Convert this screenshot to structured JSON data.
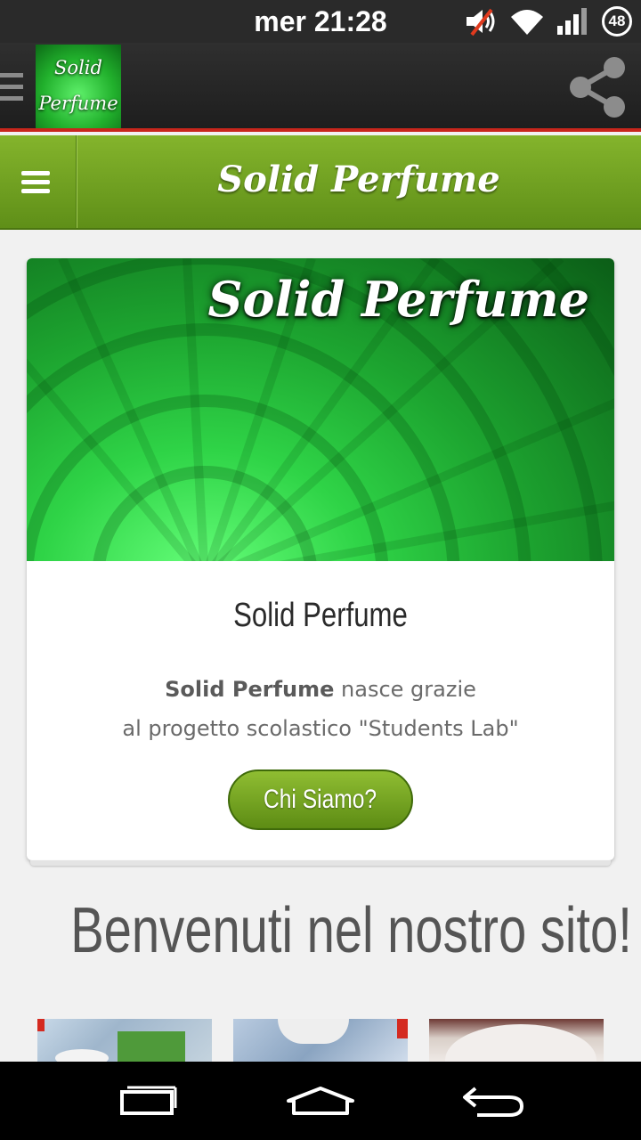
{
  "status_bar": {
    "time": "mer 21:28",
    "battery": "48",
    "icons": [
      "mute-icon",
      "wifi-icon",
      "signal-icon",
      "battery-icon"
    ]
  },
  "action_bar": {
    "logo_line1": "Solid",
    "logo_line2": "Perfume",
    "icons": [
      "drawer-icon",
      "share-icon"
    ]
  },
  "site_header": {
    "title": "Solid Perfume",
    "icon": "hamburger-menu-icon"
  },
  "card": {
    "banner_text": "Solid Perfume",
    "title": "Solid Perfume",
    "text_bold": "Solid Perfume",
    "text_line1_rest": " nasce grazie",
    "text_line2": "al progetto scolastico \"Students Lab\"",
    "button_label": "Chi Siamo?"
  },
  "welcome_heading": "Benvenuti nel nostro sito!",
  "colors": {
    "brand_green": "#6fa020",
    "accent_red": "#c8261c",
    "action_bar": "#2a2a2a"
  },
  "nav_bar": {
    "icons": [
      "recent-apps-icon",
      "home-icon",
      "back-icon"
    ]
  }
}
